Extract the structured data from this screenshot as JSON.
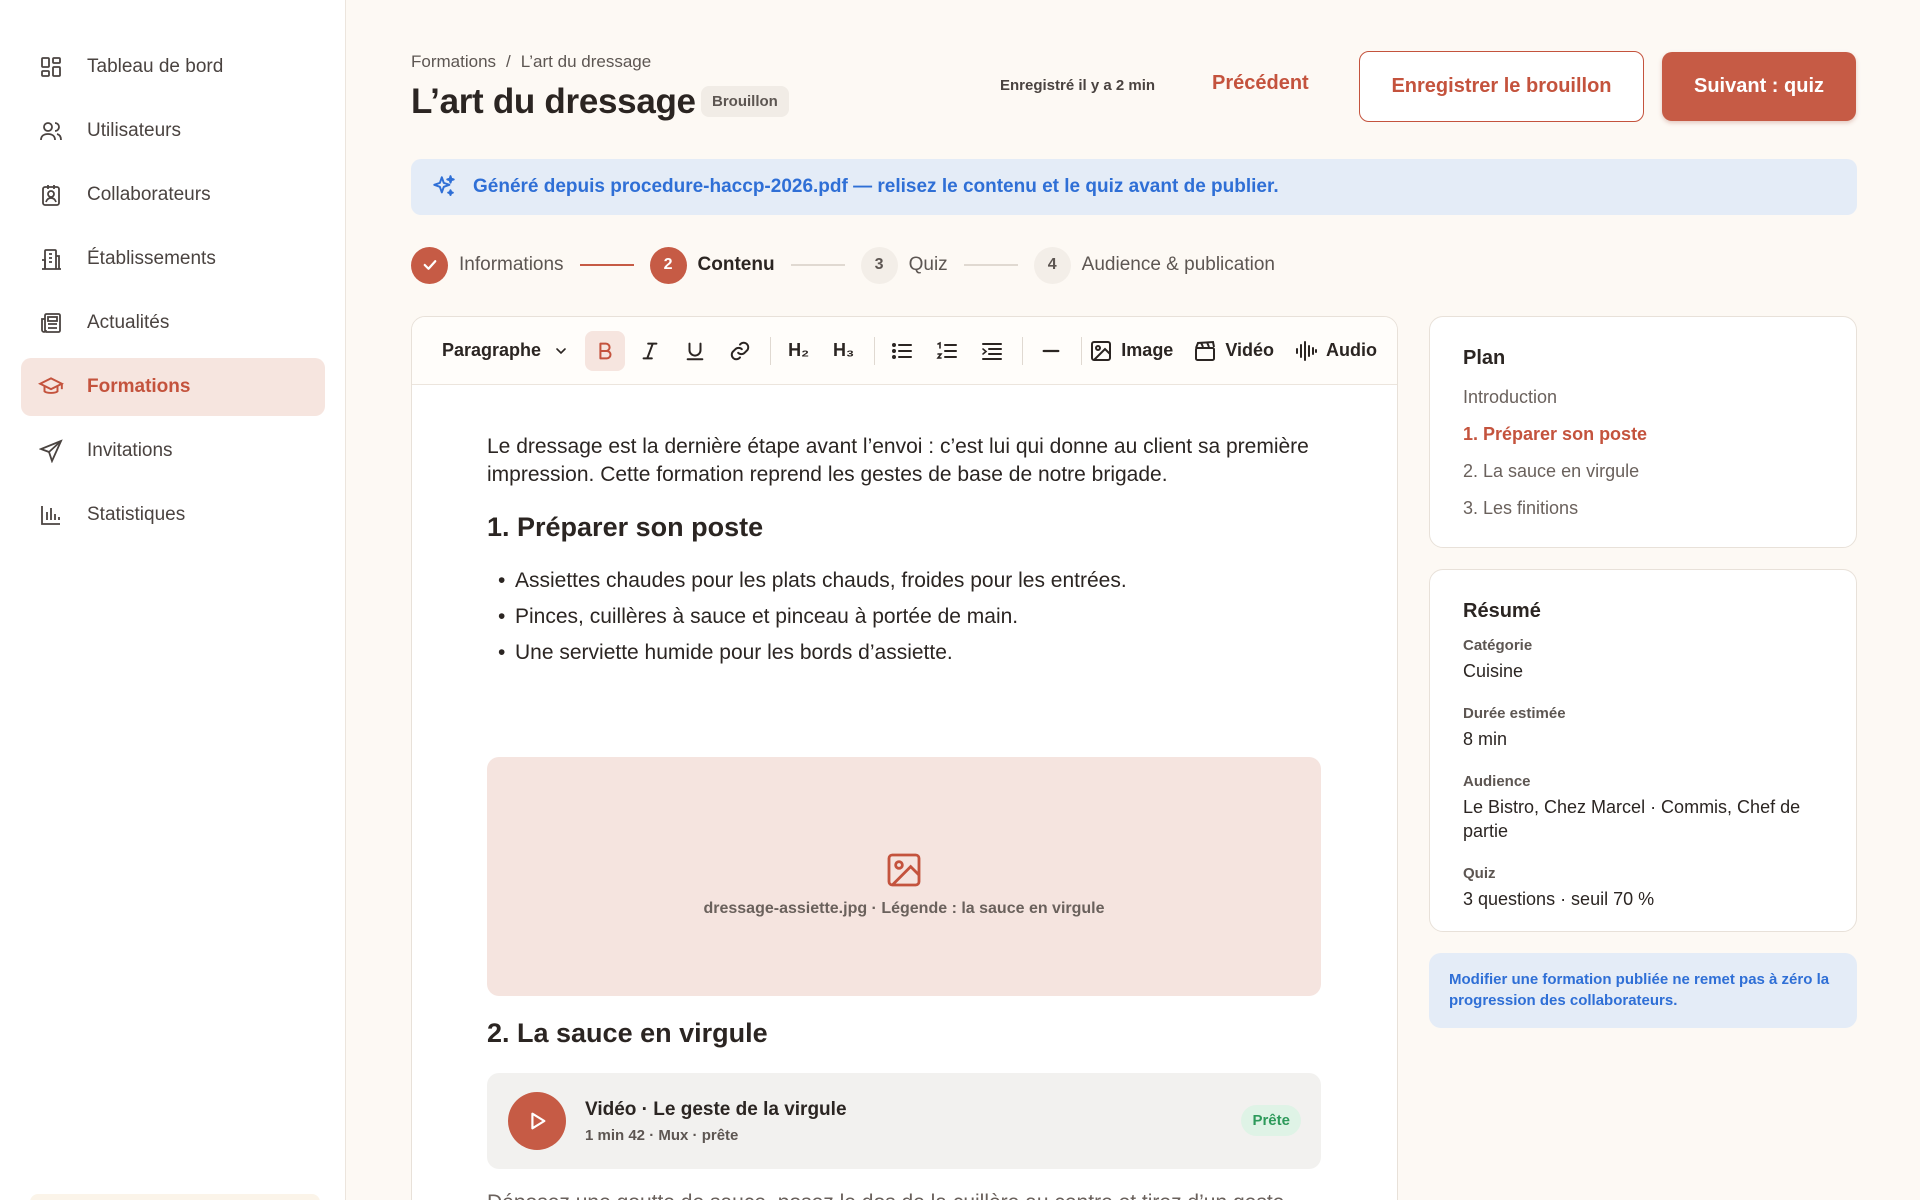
{
  "sidebar": {
    "items": [
      {
        "label": "Tableau de bord",
        "icon": "dashboard-icon"
      },
      {
        "label": "Utilisateurs",
        "icon": "users-icon"
      },
      {
        "label": "Collaborateurs",
        "icon": "badge-icon"
      },
      {
        "label": "Établissements",
        "icon": "building-icon"
      },
      {
        "label": "Actualités",
        "icon": "newspaper-icon"
      },
      {
        "label": "Formations",
        "icon": "graduation-cap-icon",
        "active": true
      },
      {
        "label": "Invitations",
        "icon": "send-icon"
      },
      {
        "label": "Statistiques",
        "icon": "bar-chart-icon"
      }
    ]
  },
  "header": {
    "breadcrumb": [
      "Formations",
      "L’art du dressage"
    ],
    "breadcrumb_sep": "/",
    "title": "L’art du dressage",
    "status_badge": "Brouillon",
    "saved_text": "Enregistré il y a 2 min",
    "prev_label": "Précédent",
    "save_draft_label": "Enregistrer le brouillon",
    "next_label": "Suivant : quiz"
  },
  "banner": {
    "text": "Généré depuis procedure-haccp-2026.pdf — relisez le contenu et le quiz avant de publier.",
    "icon": "sparkles-icon"
  },
  "steps": [
    {
      "number": "1",
      "label": "Informations",
      "state": "done"
    },
    {
      "number": "2",
      "label": "Contenu",
      "state": "current"
    },
    {
      "number": "3",
      "label": "Quiz",
      "state": "todo"
    },
    {
      "number": "4",
      "label": "Audience & publication",
      "state": "todo"
    }
  ],
  "toolbar": {
    "block_type": "Paragraphe",
    "h2": "H₂",
    "h3": "H₃",
    "image_label": "Image",
    "video_label": "Vidéo",
    "audio_label": "Audio"
  },
  "content": {
    "intro": "Le dressage est la dernière étape avant l’envoi : c’est lui qui donne au client sa première impression. Cette formation reprend les gestes de base de notre brigade.",
    "section1_title": "1. Préparer son poste",
    "bullets": [
      "Assiettes chaudes pour les plats chauds, froides pour les entrées.",
      "Pinces, cuillères à sauce et pinceau à portée de main.",
      "Une serviette humide pour les bords d’assiette."
    ],
    "image_caption": "dressage-assiette.jpg · Légende : la sauce en virgule",
    "section2_title": "2. La sauce en virgule",
    "video": {
      "title": "Vidéo · Le geste de la virgule",
      "meta": "1 min 42 · Mux · prête",
      "status": "Prête"
    },
    "para2": "Déposez une goutte de sauce, posez le dos de la cuillère au centre et tirez d’un geste continu vers l’extérieur…"
  },
  "plan": {
    "title": "Plan",
    "items": [
      "Introduction",
      "1. Préparer son poste",
      "2. La sauce en virgule",
      "3. Les finitions"
    ],
    "active_index": 1
  },
  "summary": {
    "title": "Résumé",
    "category_label": "Catégorie",
    "category_value": "Cuisine",
    "duration_label": "Durée estimée",
    "duration_value": "8 min",
    "audience_label": "Audience",
    "audience_value": "Le Bistro, Chez Marcel · Commis, Chef de partie",
    "quiz_label": "Quiz",
    "quiz_value": "3 questions · seuil 70 %"
  },
  "note": "Modifier une formation publiée ne remet pas à zéro la progression des collaborateurs.",
  "colors": {
    "accent": "#c65b45",
    "accent_soft": "#f6e5df",
    "info": "#2f6fd6",
    "info_bg": "#e4ecf7",
    "success": "#2e9a5b",
    "background": "#fdf9f4"
  }
}
